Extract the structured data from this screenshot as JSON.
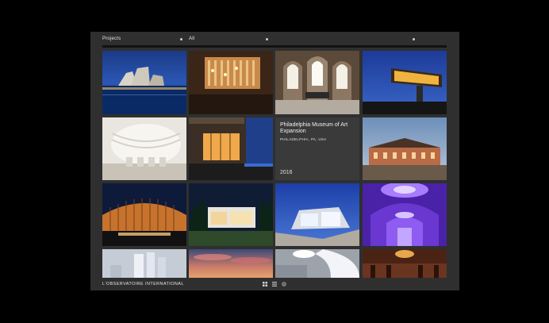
{
  "header": {
    "filter_category": "Projects",
    "filter_value": "All"
  },
  "featured": {
    "title": "Philadelphia Museum of Art Expansion",
    "location": "PHILADELPHIA, PA, USA",
    "year": "2016"
  },
  "footer": {
    "brand": "L'OBSERVATOIRE INTERNATIONAL"
  },
  "view_icons": [
    "grid-view-icon",
    "list-view-icon",
    "map-view-icon"
  ]
}
